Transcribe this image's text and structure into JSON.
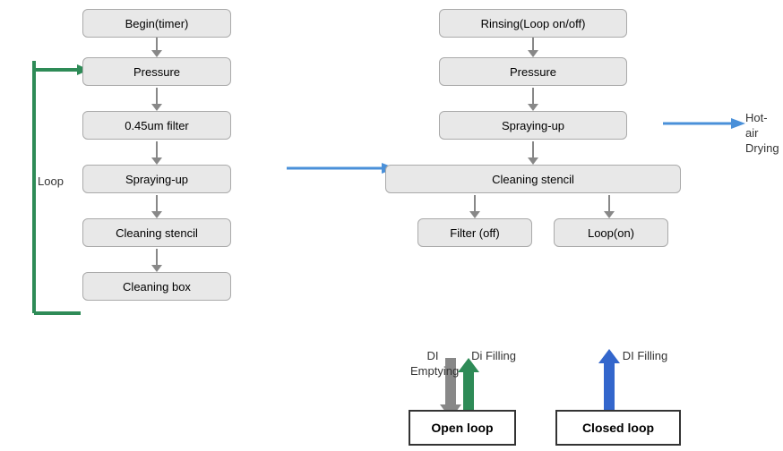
{
  "boxes": {
    "begin_timer": "Begin(timer)",
    "pressure_left": "Pressure",
    "filter": "0.45um filter",
    "spraying_left": "Spraying-up",
    "cleaning_stencil": "Cleaning stencil",
    "cleaning_box": "Cleaning box",
    "rinsing": "Rinsing(Loop on/off)",
    "pressure_right": "Pressure",
    "spraying_right": "Spraying-up",
    "cleaning_stencil_right": "Cleaning stencil",
    "filter_off": "Filter (off)",
    "loop_on": "Loop(on)",
    "open_loop": "Open loop",
    "closed_loop": "Closed loop"
  },
  "labels": {
    "loop": "Loop",
    "hot_air_drying": "Hot-air Drying",
    "di_emptying": "DI Emptying",
    "di_filling_left": "Di Filling",
    "di_filling_right": "DI Filling"
  }
}
